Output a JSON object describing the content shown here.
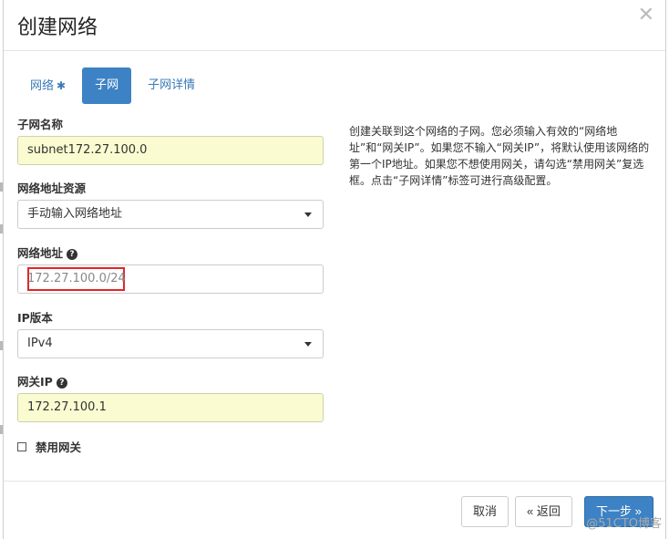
{
  "dialog": {
    "title": "创建网络",
    "close_icon": "close-icon"
  },
  "tabs": [
    {
      "label": "网络",
      "required": "✱",
      "active": false
    },
    {
      "label": "子网",
      "active": true
    },
    {
      "label": "子网详情",
      "active": false
    }
  ],
  "form": {
    "subnet_name": {
      "label": "子网名称",
      "value": "subnet172.27.100.0"
    },
    "address_source": {
      "label": "网络地址资源",
      "selected": "手动输入网络地址"
    },
    "network_address": {
      "label": "网络地址",
      "value": "172.27.100.0/24",
      "help_icon": "?"
    },
    "ip_version": {
      "label": "IP版本",
      "selected": "IPv4"
    },
    "gateway_ip": {
      "label": "网关IP",
      "value": "172.27.100.1",
      "help_icon": "?"
    },
    "disable_gateway": {
      "label": "禁用网关",
      "checked": false
    }
  },
  "help_text": "创建关联到这个网络的子网。您必须输入有效的“网络地址”和“网关IP”。如果您不输入“网关IP”，将默认使用该网络的第一个IP地址。如果您不想使用网关，请勾选“禁用网关”复选框。点击“子网详情”标签可进行高级配置。",
  "footer": {
    "cancel": "取消",
    "back": "« 返回",
    "next": "下一步 »"
  },
  "watermark": "@51CTO博客",
  "colors": {
    "primary": "#3d82c4",
    "autofill": "#fafbd0",
    "highlight": "#e0262b"
  }
}
